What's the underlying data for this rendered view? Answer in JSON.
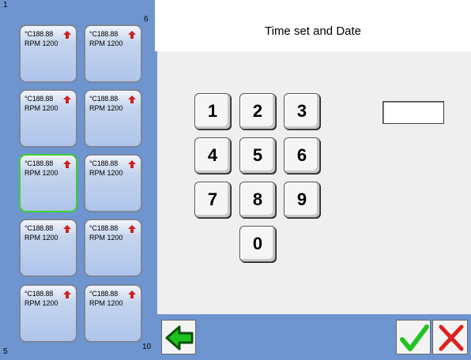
{
  "header": {
    "title": "Time set and Date"
  },
  "stations": {
    "corner_top_left": "1",
    "corner_top_right": "6",
    "corner_bottom_left": "5",
    "corner_bottom_right": "10",
    "temp_unit": "°C",
    "temp_value": "188.88",
    "rpm_label": "RPM 1200",
    "active_index": 2,
    "arrow_color": "#d02020",
    "active_color": "#38d32a"
  },
  "keypad": {
    "keys": [
      "1",
      "2",
      "3",
      "4",
      "5",
      "6",
      "7",
      "8",
      "9",
      "0"
    ]
  },
  "input": {
    "value": ""
  },
  "toolbar": {
    "back_icon": "green-left-arrow-icon",
    "ok_icon": "green-checkmark-icon",
    "cancel_icon": "red-x-icon"
  }
}
